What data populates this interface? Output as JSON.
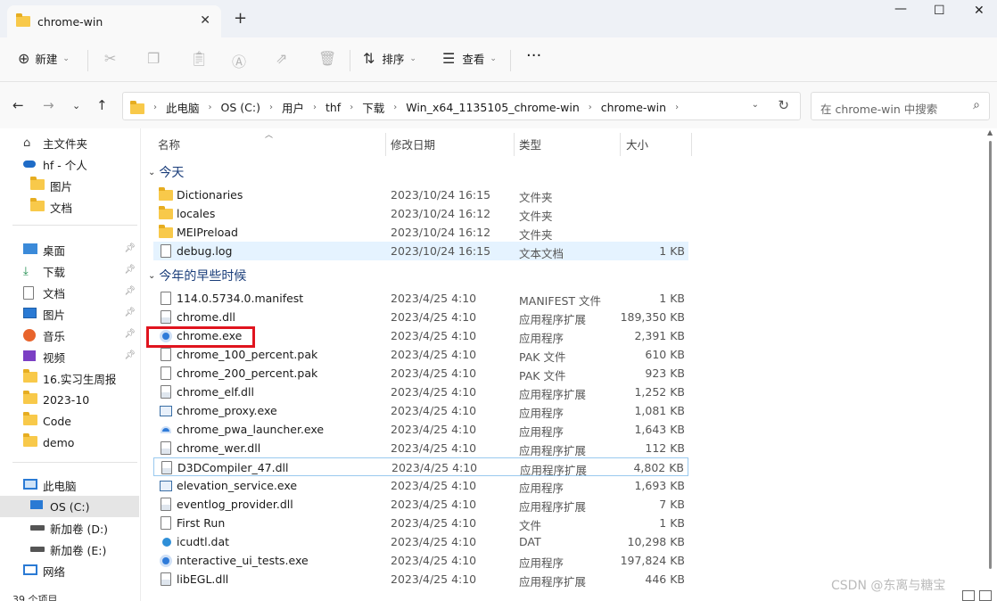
{
  "window": {
    "tab_title": "chrome-win",
    "tab_close": "✕",
    "new_tab": "+",
    "minimize": "—",
    "maximize": "☐",
    "close": "✕"
  },
  "toolbar": {
    "new_label": "新建",
    "sort_label": "排序",
    "view_label": "查看",
    "more": "···"
  },
  "address": {
    "crumbs": [
      "此电脑",
      "OS (C:)",
      "用户",
      "thf",
      "下载",
      "Win_x64_1135105_chrome-win",
      "chrome-win"
    ],
    "search_placeholder": "在 chrome-win 中搜索"
  },
  "nav": {
    "items": [
      {
        "label": "主文件夹",
        "icon": "home-icon"
      },
      {
        "label": "hf - 个人",
        "icon": "onedrive-icon"
      },
      {
        "label": "图片",
        "icon": "folder-icon"
      },
      {
        "label": "文档",
        "icon": "folder-icon"
      },
      {
        "label": "桌面",
        "icon": "desktop-icon"
      },
      {
        "label": "下载",
        "icon": "download-icon"
      },
      {
        "label": "文档",
        "icon": "documents-icon"
      },
      {
        "label": "图片",
        "icon": "pictures-icon"
      },
      {
        "label": "音乐",
        "icon": "music-icon"
      },
      {
        "label": "视频",
        "icon": "video-icon"
      },
      {
        "label": "16.实习生周报",
        "icon": "folder-icon"
      },
      {
        "label": "2023-10",
        "icon": "folder-icon"
      },
      {
        "label": "Code",
        "icon": "folder-icon"
      },
      {
        "label": "demo",
        "icon": "folder-icon"
      },
      {
        "label": "此电脑",
        "icon": "pc-icon"
      },
      {
        "label": "OS (C:)",
        "icon": "os-drive-icon"
      },
      {
        "label": "新加卷 (D:)",
        "icon": "drive-icon"
      },
      {
        "label": "新加卷 (E:)",
        "icon": "drive-icon"
      },
      {
        "label": "网络",
        "icon": "network-icon"
      }
    ]
  },
  "columns": {
    "name": "名称",
    "date": "修改日期",
    "type": "类型",
    "size": "大小"
  },
  "groups": {
    "today": "今天",
    "earlier": "今年的早些时候"
  },
  "files_today": [
    {
      "name": "Dictionaries",
      "date": "2023/10/24 16:15",
      "type": "文件夹",
      "size": "",
      "icon": "folder-icon"
    },
    {
      "name": "locales",
      "date": "2023/10/24 16:12",
      "type": "文件夹",
      "size": "",
      "icon": "folder-icon"
    },
    {
      "name": "MEIPreload",
      "date": "2023/10/24 16:12",
      "type": "文件夹",
      "size": "",
      "icon": "folder-icon"
    },
    {
      "name": "debug.log",
      "date": "2023/10/24 16:15",
      "type": "文本文档",
      "size": "1 KB",
      "icon": "text-file-icon"
    }
  ],
  "files_earlier": [
    {
      "name": "114.0.5734.0.manifest",
      "date": "2023/4/25 4:10",
      "type": "MANIFEST 文件",
      "size": "1 KB",
      "icon": "file-icon"
    },
    {
      "name": "chrome.dll",
      "date": "2023/4/25 4:10",
      "type": "应用程序扩展",
      "size": "189,350 KB",
      "icon": "dll-icon"
    },
    {
      "name": "chrome.exe",
      "date": "2023/4/25 4:10",
      "type": "应用程序",
      "size": "2,391 KB",
      "icon": "chrome-icon"
    },
    {
      "name": "chrome_100_percent.pak",
      "date": "2023/4/25 4:10",
      "type": "PAK 文件",
      "size": "610 KB",
      "icon": "file-icon"
    },
    {
      "name": "chrome_200_percent.pak",
      "date": "2023/4/25 4:10",
      "type": "PAK 文件",
      "size": "923 KB",
      "icon": "file-icon"
    },
    {
      "name": "chrome_elf.dll",
      "date": "2023/4/25 4:10",
      "type": "应用程序扩展",
      "size": "1,252 KB",
      "icon": "dll-icon"
    },
    {
      "name": "chrome_proxy.exe",
      "date": "2023/4/25 4:10",
      "type": "应用程序",
      "size": "1,081 KB",
      "icon": "exe-icon"
    },
    {
      "name": "chrome_pwa_launcher.exe",
      "date": "2023/4/25 4:10",
      "type": "应用程序",
      "size": "1,643 KB",
      "icon": "pwa-icon"
    },
    {
      "name": "chrome_wer.dll",
      "date": "2023/4/25 4:10",
      "type": "应用程序扩展",
      "size": "112 KB",
      "icon": "dll-icon"
    },
    {
      "name": "D3DCompiler_47.dll",
      "date": "2023/4/25 4:10",
      "type": "应用程序扩展",
      "size": "4,802 KB",
      "icon": "dll-icon"
    },
    {
      "name": "elevation_service.exe",
      "date": "2023/4/25 4:10",
      "type": "应用程序",
      "size": "1,693 KB",
      "icon": "exe-icon"
    },
    {
      "name": "eventlog_provider.dll",
      "date": "2023/4/25 4:10",
      "type": "应用程序扩展",
      "size": "7 KB",
      "icon": "dll-icon"
    },
    {
      "name": "First Run",
      "date": "2023/4/25 4:10",
      "type": "文件",
      "size": "1 KB",
      "icon": "file-icon"
    },
    {
      "name": "icudtl.dat",
      "date": "2023/4/25 4:10",
      "type": "DAT",
      "size": "10,298 KB",
      "icon": "dat-icon"
    },
    {
      "name": "interactive_ui_tests.exe",
      "date": "2023/4/25 4:10",
      "type": "应用程序",
      "size": "197,824 KB",
      "icon": "chrome-icon"
    },
    {
      "name": "libEGL.dll",
      "date": "2023/4/25 4:10",
      "type": "应用程序扩展",
      "size": "446 KB",
      "icon": "dll-icon"
    }
  ],
  "status": {
    "item_count": "39 个项目"
  },
  "watermark": "CSDN @东离与糖宝",
  "colors": {
    "folder": "#f8c94a",
    "highlight": "#e5f3ff",
    "annotation_box": "#e0141e",
    "group_header": "#1a3d7a"
  }
}
